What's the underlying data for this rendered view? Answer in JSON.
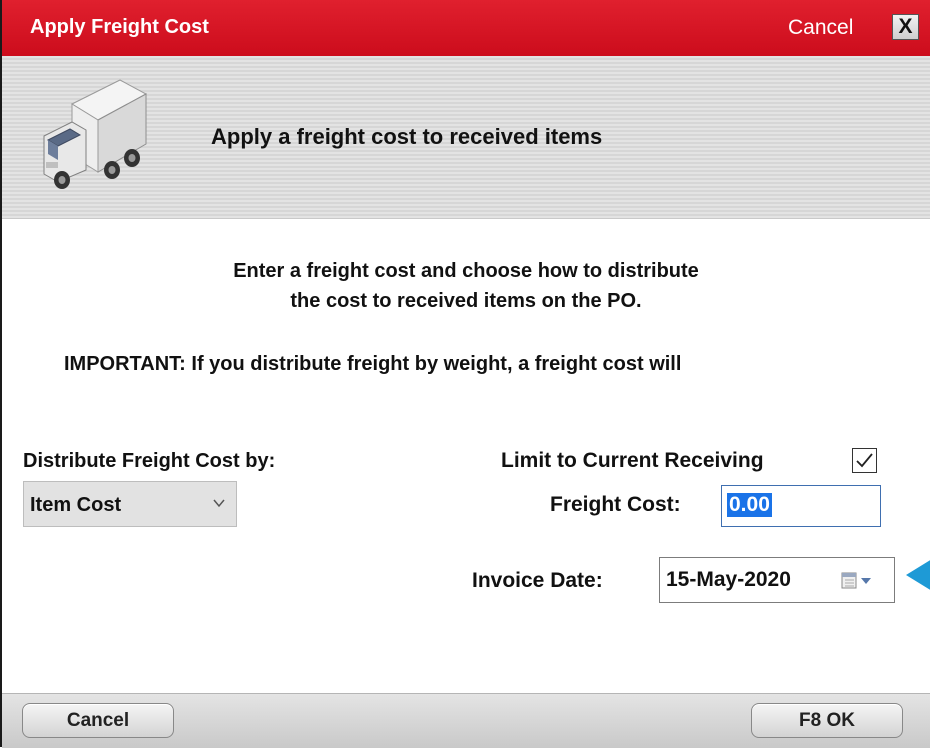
{
  "window": {
    "title": "Apply Freight Cost",
    "cancel_label": "Cancel",
    "close_label": "X"
  },
  "header": {
    "title": "Apply a freight cost to received items",
    "icon": "truck-icon"
  },
  "instructions": {
    "line1": "Enter a freight cost and choose how to distribute",
    "line2": "the cost to received items on the PO.",
    "important": "IMPORTANT: If you distribute freight by weight, a freight cost will"
  },
  "form": {
    "distribute_label": "Distribute Freight Cost by:",
    "distribute_value": "Item Cost",
    "limit_label": "Limit to Current Receiving",
    "limit_checked": true,
    "freight_label": "Freight Cost:",
    "freight_value": "0.00",
    "invoice_label": "Invoice Date:",
    "invoice_value": "15-May-2020"
  },
  "footer": {
    "cancel_label": "Cancel",
    "ok_label": "F8 OK"
  },
  "colors": {
    "titlebar": "#d91424",
    "selection": "#1a73e8",
    "pointer": "#1e9ad6"
  }
}
